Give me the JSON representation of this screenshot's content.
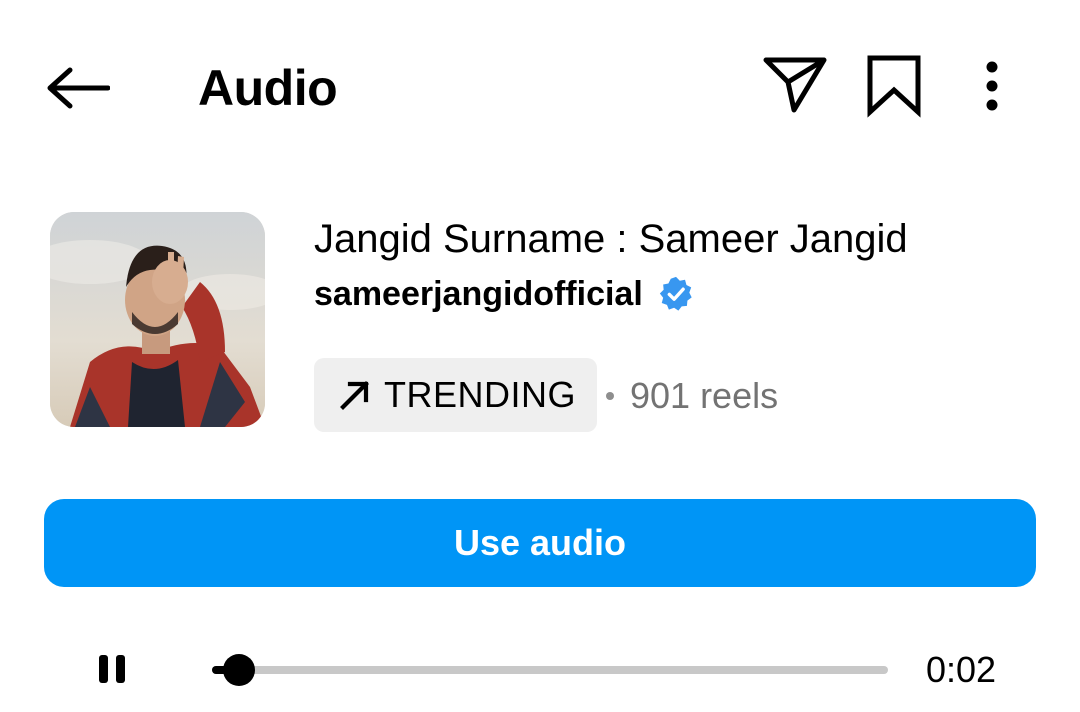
{
  "header": {
    "title": "Audio",
    "icons": {
      "back": "arrow-left-icon",
      "share": "paper-plane-icon",
      "save": "bookmark-icon",
      "more": "more-vertical-icon"
    }
  },
  "track": {
    "title": "Jangid Surname : Sameer Jangid",
    "artist": "sameerjangidofficial",
    "verified": true,
    "badge_label": "TRENDING",
    "reels_count": "901 reels"
  },
  "actions": {
    "use_audio_label": "Use audio"
  },
  "player": {
    "state": "playing",
    "progress_fraction": 0.04,
    "elapsed": "0:02"
  },
  "colors": {
    "accent": "#0095f6",
    "verified": "#3897f0",
    "badge_bg": "#efefef",
    "secondary_text": "#737373",
    "track_bg": "#c8c8c8"
  }
}
